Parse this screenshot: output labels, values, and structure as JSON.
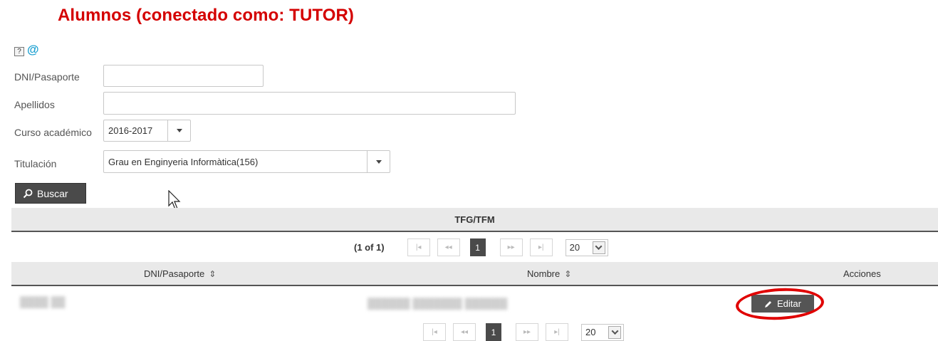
{
  "page": {
    "title": "Alumnos (conectado como: TUTOR)",
    "help_glyph": "?",
    "at_glyph": "@"
  },
  "form": {
    "dni_label": "DNI/Pasaporte",
    "dni_value": "",
    "apellidos_label": "Apellidos",
    "apellidos_value": "",
    "curso_label": "Curso académico",
    "curso_value": "2016-2017",
    "titulacion_label": "Titulación",
    "titulacion_value": "Grau en Enginyeria Informàtica(156)",
    "search_button": "Buscar"
  },
  "table": {
    "caption": "TFG/TFM",
    "page_report": "(1 of 1)",
    "current_page": "1",
    "rows_per_page": "20",
    "columns": [
      "DNI/Pasaporte",
      "Nombre",
      "Acciones"
    ],
    "rows": [
      {
        "dni": "████ ██",
        "nombre": "██████ ███████ ██████",
        "action": "Editar"
      }
    ]
  },
  "icons": {
    "help": "help-icon",
    "at": "at-icon",
    "search": "search-icon",
    "edit": "pencil-icon",
    "sort": "sort-icon",
    "cursor": "mouse-cursor-icon"
  },
  "colors": {
    "title": "#d40000",
    "button_bg": "#4a4a4a",
    "header_bg": "#e9e9e9",
    "annotation_ring": "#e00000",
    "at_icon": "#1a9fd0"
  }
}
